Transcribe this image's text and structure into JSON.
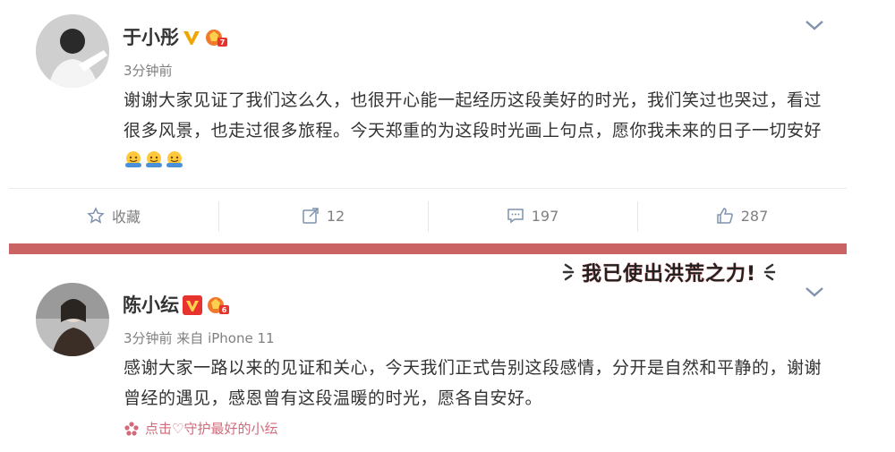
{
  "post1": {
    "author": "于小彤",
    "time": "3分钟前",
    "text": "谢谢大家见证了我们这么久，也很开心能一起经历这段美好的时光，我们笑过也哭过，看过很多风景，也走过很多旅程。今天郑重的为这段时光画上句点，愿你我未来的日子一切安好",
    "emojis": [
      "hug-emoji",
      "hug-emoji",
      "hug-emoji"
    ],
    "actions": {
      "favorite_label": "收藏",
      "repost_count": "12",
      "comment_count": "197",
      "like_count": "287"
    }
  },
  "sticker": {
    "text": "我已使出洪荒之力!"
  },
  "post2": {
    "author": "陈小纭",
    "meta": "3分钟前 来自 iPhone 11",
    "text": "感谢大家一路以来的见证和关心，今天我们正式告别这段感情，分开是自然和平静的，谢谢曾经的遇见，感恩曾有这段温暖的时光，愿各自安好。",
    "link": "点击♡守护最好的小纭"
  },
  "colors": {
    "divider": "#c96364",
    "verified": "#f0a600",
    "verified_red": "#e8322d",
    "link_pink": "#d26a7a"
  }
}
